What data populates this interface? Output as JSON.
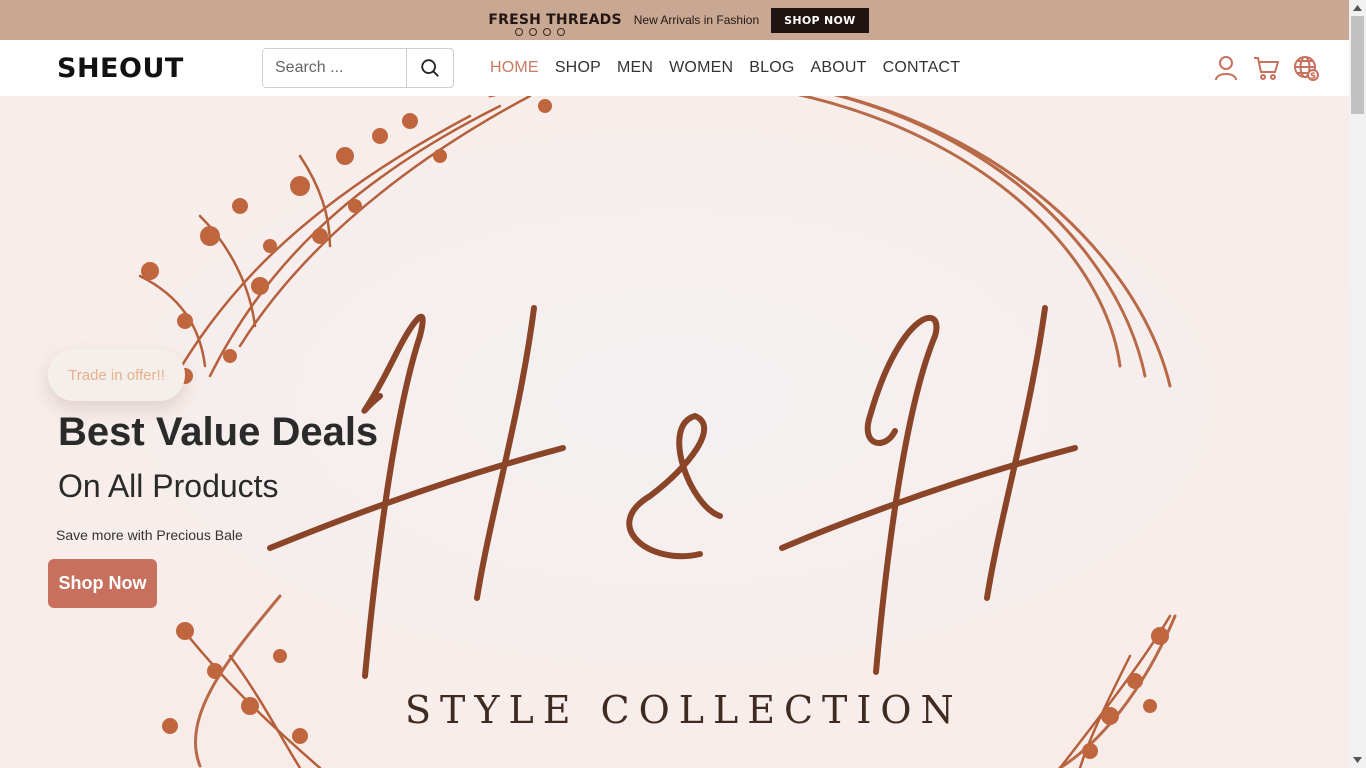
{
  "promo": {
    "brand": "FRESH THREADS",
    "text": "New Arrivals in Fashion",
    "button": "SHOP NOW",
    "slide_count": 4
  },
  "header": {
    "logo": "SHEOUT",
    "search_placeholder": "Search ...",
    "nav": [
      "HOME",
      "SHOP",
      "MEN",
      "WOMEN",
      "BLOG",
      "ABOUT",
      "CONTACT"
    ],
    "active_nav": "HOME",
    "icons": [
      "user-icon",
      "cart-icon",
      "currency-globe-icon"
    ]
  },
  "hero": {
    "badge": "Trade in offer!!",
    "title": "Best Value Deals",
    "subtitle": "On All Products",
    "description": "Save more with Precious Bale",
    "button": "Shop Now",
    "image_monogram": "H & H",
    "image_caption": "STYLE COLLECTION"
  },
  "colors": {
    "promo_bg": "#c8a892",
    "accent": "#c87a62",
    "button": "#c8705e",
    "hero_bg": "#f7eeec",
    "ink": "#8a4428"
  }
}
